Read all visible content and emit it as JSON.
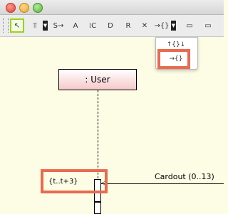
{
  "toolbar": {
    "tools": [
      {
        "name": "select-tool",
        "glyph": "↖"
      },
      {
        "name": "lifeline-tool",
        "glyph": "⫪"
      },
      {
        "name": "message-tool",
        "glyph": "S→"
      },
      {
        "name": "text-tool",
        "glyph": "A"
      },
      {
        "name": "create-tool",
        "glyph": "⁞C"
      },
      {
        "name": "destroy-tool",
        "glyph": "D"
      },
      {
        "name": "return-tool",
        "glyph": "R"
      },
      {
        "name": "delete-tool",
        "glyph": "✕"
      },
      {
        "name": "timing-tool",
        "glyph": "→{}"
      },
      {
        "name": "frame-tool",
        "glyph": "▭"
      },
      {
        "name": "note-tool",
        "glyph": "▭"
      }
    ]
  },
  "popup": {
    "items": [
      {
        "name": "duration-constraint-item",
        "glyph": "↑{}↓"
      },
      {
        "name": "time-constraint-item",
        "glyph": "→{}"
      }
    ]
  },
  "diagram": {
    "lifeline_label": ": User",
    "constraint_label": "{t..t+3}",
    "message_label": "Cardout (0..13)"
  }
}
